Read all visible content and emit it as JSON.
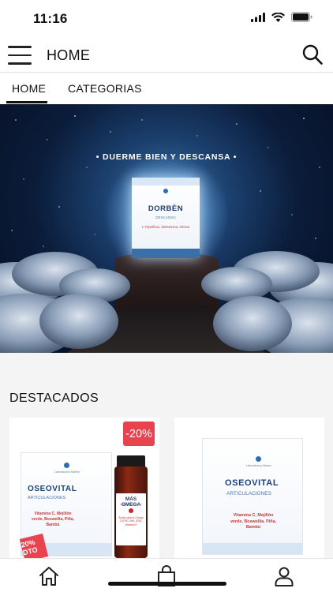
{
  "status_bar": {
    "time": "11:16",
    "icons": [
      "signal-icon",
      "wifi-icon",
      "battery-icon"
    ]
  },
  "header": {
    "title": "HOME",
    "menu_icon": "hamburger-menu-icon",
    "search_icon": "search-icon"
  },
  "tabs": [
    {
      "label": "HOME",
      "active": true
    },
    {
      "label": "CATEGORIAS",
      "active": false
    }
  ],
  "banner": {
    "tagline": "• DUERME BIEN Y DESCANSA •",
    "product": {
      "name": "DORBÈN",
      "subtitle": "DESCANSO",
      "ingredients": "L-Triptófano, Melatonina, Glicina"
    }
  },
  "featured": {
    "title": "DESTACADOS",
    "cards": [
      {
        "badge": "-20%",
        "box": {
          "brand": "Laboratorios Mahen",
          "name": "OSEOVITAL",
          "subtitle": "ARTICULACIONES",
          "ingredients": "Vitamina C, Mejillón verde, Boswellia, Piña, Bambú"
        },
        "bottle": {
          "name": "MÁS OMEGA",
          "subtitle": "CARDIOVASCULAR",
          "ingredients": "Ácidos grasos Omega 3 (EPA, DHA, DPA), Vitamina E"
        },
        "corner_badge": "20% DTO"
      },
      {
        "box": {
          "brand": "Laboratorios Mahen",
          "name": "OSEOVITAL",
          "subtitle": "ARTICULACIONES",
          "ingredients": "Vitamina C, Mejillón verde, Boswellia, Piña, Bambú"
        }
      }
    ]
  },
  "bottom_nav": {
    "items": [
      "home-icon",
      "shopping-bag-icon",
      "user-icon"
    ]
  },
  "colors": {
    "accent": "#e8434f",
    "brand_blue": "#1e3f73",
    "section_bg": "#f4f4f4"
  }
}
